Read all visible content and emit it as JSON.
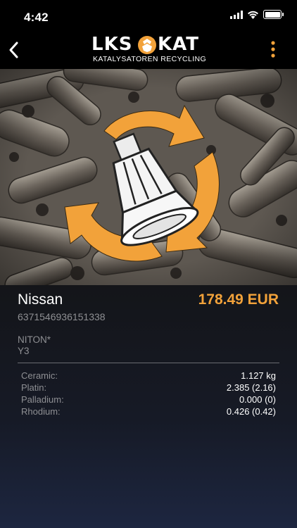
{
  "status_bar": {
    "time": "4:42"
  },
  "logo": {
    "left_word": "LKS",
    "right_word": "KAT",
    "subtitle": "KATALYSATOREN RECYCLING"
  },
  "product": {
    "make": "Nissan",
    "price": "178.49 EUR",
    "code": "6371546936151338",
    "model": "NITON*",
    "variant": "Y3"
  },
  "metals": [
    {
      "name": "Ceramic:",
      "value": "1.127 kg"
    },
    {
      "name": "Platin:",
      "value": "2.385 (2.16)"
    },
    {
      "name": "Palladium:",
      "value": "0.000 (0)"
    },
    {
      "name": "Rhodium:",
      "value": "0.426 (0.42)"
    }
  ],
  "colors": {
    "accent": "#f2a23a",
    "background": "#141519",
    "muted_text": "#8e8f93"
  },
  "icons": {
    "back": "chevron-left-icon",
    "more": "more-vertical-icon",
    "recycle": "recycling-arrows-icon",
    "converter": "catalytic-converter-icon"
  }
}
